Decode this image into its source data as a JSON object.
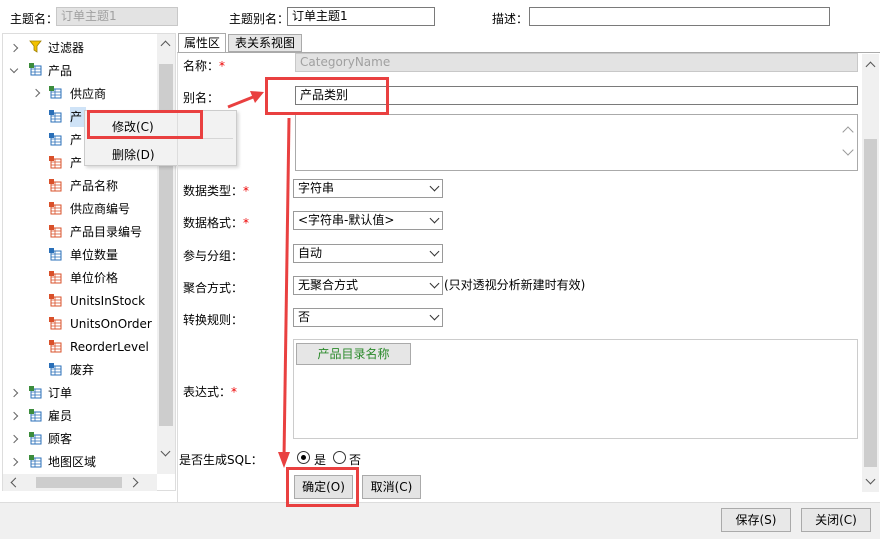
{
  "header": {
    "topic_name_label": "主题名：",
    "topic_name_value": "订单主题1",
    "topic_alias_label": "主题别名：",
    "topic_alias_value": "订单主题1",
    "description_label": "描述：",
    "description_value": ""
  },
  "tree": {
    "filter": "过滤器",
    "product": "产品",
    "supplier": "供应商",
    "items": [
      "产",
      "产",
      "产",
      "产品名称",
      "供应商编号",
      "产品目录编号",
      "单位数量",
      "单位价格",
      "UnitsInStock",
      "UnitsOnOrder",
      "ReorderLevel",
      "废弃"
    ],
    "order": "订单",
    "employee": "雇员",
    "customer": "顾客",
    "map_region": "地图区域"
  },
  "context_menu": {
    "modify": "修改(C)",
    "delete": "删除(D)"
  },
  "tabs": {
    "properties": "属性区",
    "relations": "表关系视图"
  },
  "form": {
    "name_label": "名称：",
    "name_value": "CategoryName",
    "alias_label": "别名：",
    "alias_value": "产品类别",
    "data_type_label": "数据类型：",
    "data_type_value": "字符串",
    "data_format_label": "数据格式：",
    "data_format_value": "<字符串-默认值>",
    "grouping_label": "参与分组：",
    "grouping_value": "自动",
    "aggregation_label": "聚合方式：",
    "aggregation_value": "无聚合方式",
    "aggregation_note": "(只对透视分析新建时有效)",
    "convert_label": "转换规则：",
    "convert_value": "否",
    "expression_label": "表达式：",
    "expression_token": "产品目录名称",
    "gen_sql_label": "是否生成SQL：",
    "gen_sql_yes": "是",
    "gen_sql_no": "否",
    "required_mark": "*"
  },
  "buttons": {
    "ok": "确定(O)",
    "cancel": "取消(C)",
    "save": "保存(S)",
    "close": "关闭(C)"
  },
  "colors": {
    "annotation_red": "#e94040",
    "token_green": "#2a8a2a"
  }
}
